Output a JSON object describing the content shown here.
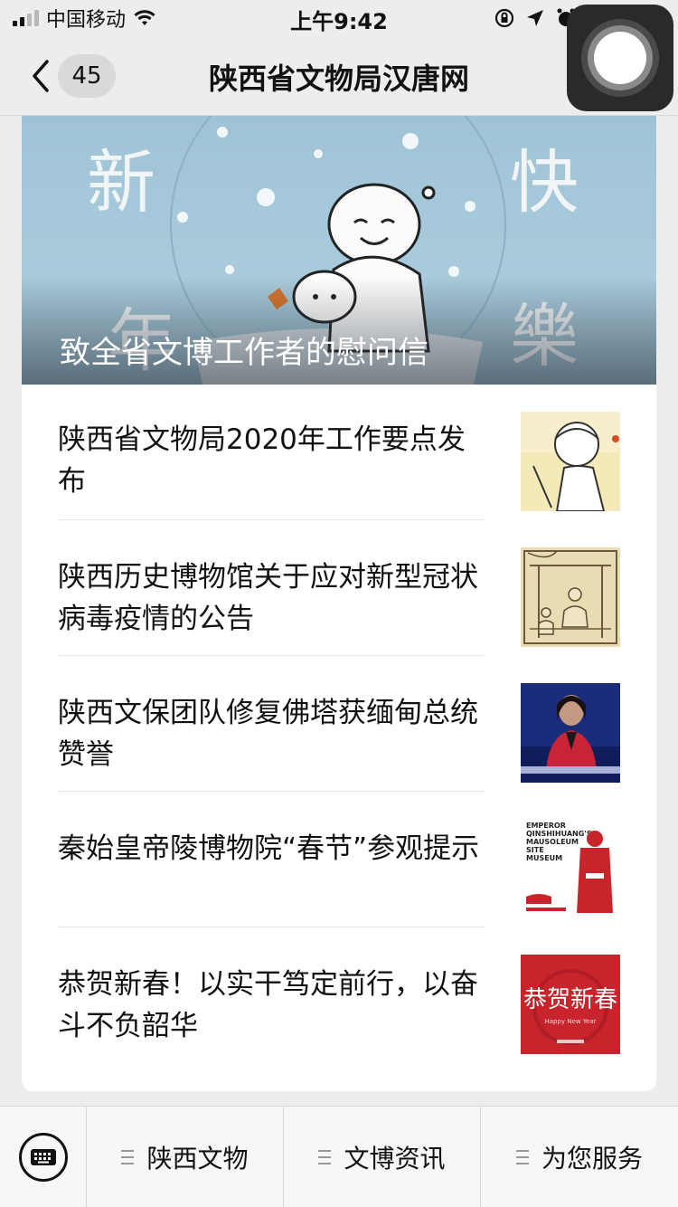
{
  "status_bar": {
    "carrier": "中国移动",
    "time": "上午9:42"
  },
  "nav": {
    "back_count": "45",
    "title": "陕西省文物局汉唐网"
  },
  "hero": {
    "title": "致全省文博工作者的慰问信",
    "art_chars": [
      "新",
      "年",
      "快",
      "樂"
    ]
  },
  "articles": [
    {
      "title": "陕西省文物局2020年工作要点发布",
      "thumb": "cartoon-sketch"
    },
    {
      "title": "陕西历史博物馆关于应对新型冠状病毒疫情的公告",
      "thumb": "ancient-drawing"
    },
    {
      "title": "陕西文保团队修复佛塔获缅甸总统赞誉",
      "thumb": "news-anchor"
    },
    {
      "title": "秦始皇帝陵博物院“春节”参观提示",
      "thumb": "museum-poster",
      "poster_text": [
        "EMPEROR",
        "QINSHIHUANG'S",
        "MAUSOLEUM",
        "SITE",
        "MUSEUM"
      ]
    },
    {
      "title": "恭贺新春！以实干笃定前行，以奋斗不负韶华",
      "thumb": "new-year-card",
      "card_text": "恭贺新春",
      "card_subtext": "Happy New Year"
    }
  ],
  "bottom_menu": {
    "tabs": [
      {
        "label": "陕西文物"
      },
      {
        "label": "文博资讯"
      },
      {
        "label": "为您服务"
      }
    ]
  },
  "colors": {
    "accent_red": "#c8242b",
    "background": "#ededed"
  }
}
